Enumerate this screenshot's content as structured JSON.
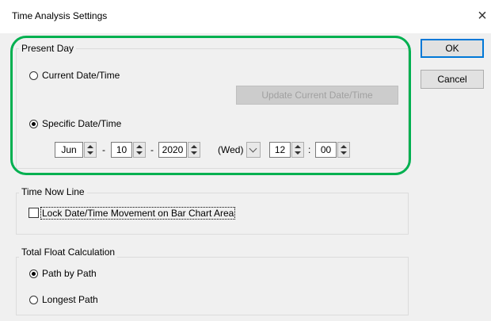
{
  "dialog": {
    "title": "Time Analysis Settings",
    "close_glyph": "×"
  },
  "buttons": {
    "ok_label": "OK",
    "cancel_label": "Cancel",
    "update_label": "Update Current Date/Time"
  },
  "present_day": {
    "legend": "Present Day",
    "current_label": "Current Date/Time",
    "current_selected": false,
    "specific_label": "Specific Date/Time",
    "specific_selected": true,
    "month": "Jun",
    "day": "10",
    "year": "2020",
    "date_sep": "-",
    "weekday": "(Wed)",
    "hour": "12",
    "time_sep": ":",
    "minute": "00"
  },
  "time_now_line": {
    "legend": "Time Now Line",
    "lock_label": "Lock Date/Time Movement on Bar Chart Area",
    "lock_checked": false
  },
  "total_float": {
    "legend": "Total Float Calculation",
    "path_by_path_label": "Path by Path",
    "path_by_path_selected": true,
    "longest_path_label": "Longest Path",
    "longest_path_selected": false
  },
  "colors": {
    "highlight": "#00b050",
    "default_button_border": "#0078d7"
  },
  "icons": {
    "close": "close-icon",
    "spin_up": "spin-up-icon",
    "spin_down": "spin-down-icon",
    "dropdown": "chevron-down-icon"
  }
}
